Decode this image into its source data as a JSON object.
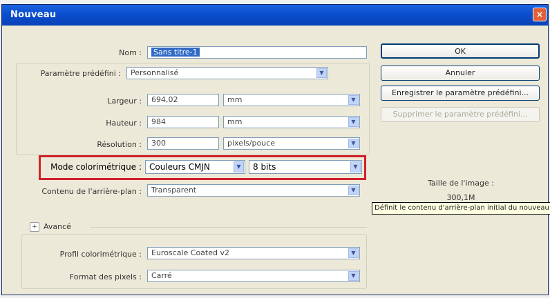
{
  "window": {
    "title": "Nouveau",
    "close_label": "×"
  },
  "name": {
    "label": "Nom :",
    "value": "Sans titre-1"
  },
  "preset": {
    "label": "Paramètre prédéfini :",
    "value": "Personnalisé"
  },
  "width": {
    "label": "Largeur :",
    "value": "694,02",
    "unit": "mm"
  },
  "height": {
    "label": "Hauteur :",
    "value": "984",
    "unit": "mm"
  },
  "resolution": {
    "label": "Résolution :",
    "value": "300",
    "unit": "pixels/pouce"
  },
  "color_mode": {
    "label": "Mode colorimétrique :",
    "value": "Couleurs CMJN",
    "bits": "8 bits"
  },
  "background": {
    "label": "Contenu de l'arrière-plan :",
    "value": "Transparent"
  },
  "advanced": {
    "label": "Avancé",
    "toggle": "+"
  },
  "color_profile": {
    "label": "Profil colorimétrique :",
    "value": "Euroscale Coated v2"
  },
  "pixel_format": {
    "label": "Format des pixels :",
    "value": "Carré"
  },
  "buttons": {
    "ok": "OK",
    "cancel": "Annuler",
    "save_preset": "Enregistrer le paramètre prédéfini...",
    "delete_preset": "Supprimer le paramètre prédéfini..."
  },
  "image_size": {
    "label": "Taille de l'image :",
    "value": "300,1M"
  },
  "tooltip": "Définit le contenu d'arrière-plan initial du nouveau document",
  "colors": {
    "highlight": "#d0202a",
    "titlebar": "#0b4fd0",
    "selection": "#316ac5"
  },
  "icons": {
    "dropdown": "chevron-down-icon",
    "close": "close-icon",
    "expand": "expand-icon"
  }
}
